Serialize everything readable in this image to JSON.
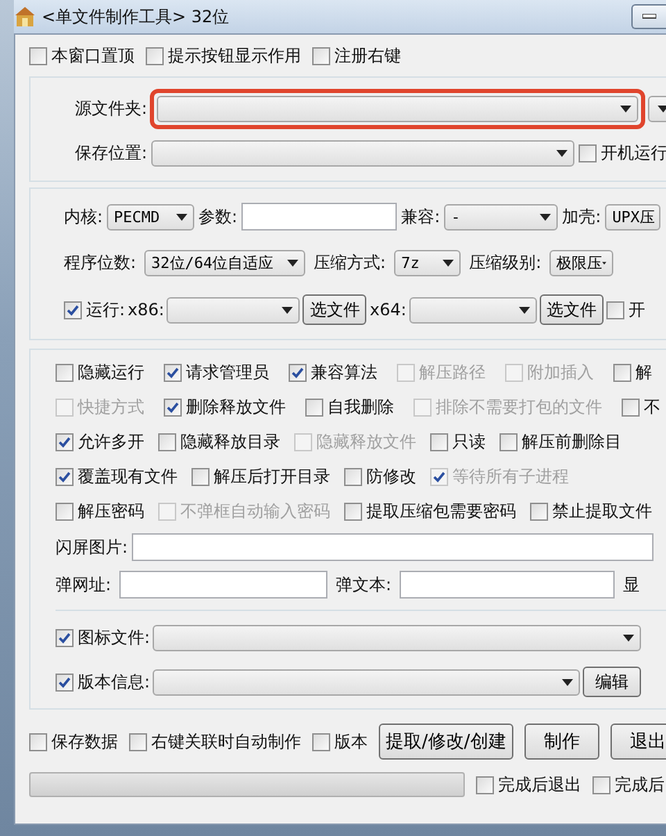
{
  "window": {
    "title": "<单文件制作工具> 32位"
  },
  "top_options": [
    {
      "label": "本窗口置顶",
      "checked": false
    },
    {
      "label": "提示按钮显示作用",
      "checked": false
    },
    {
      "label": "注册右键",
      "checked": false
    }
  ],
  "source": {
    "label": "源文件夹:",
    "highlighted": true
  },
  "save": {
    "label": "保存位置:"
  },
  "autostart": {
    "label": "开机运行",
    "checked": false
  },
  "core": {
    "label": "内核:",
    "value": "PECMD"
  },
  "params": {
    "label": "参数:"
  },
  "compat": {
    "label": "兼容:",
    "value": "-"
  },
  "packer": {
    "label": "加壳:",
    "value": "UPX压"
  },
  "bits": {
    "label": "程序位数:",
    "value": "32位/64位自适应"
  },
  "compression": {
    "label": "压缩方式:",
    "value": "7z"
  },
  "compression_level": {
    "label": "压缩级别:",
    "value": "极限压"
  },
  "run": {
    "label": "运行:",
    "checked": true,
    "x86_label": "x86:",
    "x86_button": "选文件",
    "x64_label": "x64:",
    "x64_button": "选文件"
  },
  "run_extra": {
    "label": "开",
    "checked": false
  },
  "options": [
    [
      {
        "label": "隐藏运行",
        "checked": false,
        "disabled": false
      },
      {
        "label": "请求管理员",
        "checked": true,
        "disabled": false
      },
      {
        "label": "兼容算法",
        "checked": true,
        "disabled": false
      },
      {
        "label": "解压路径",
        "checked": false,
        "disabled": true
      },
      {
        "label": "附加插入",
        "checked": false,
        "disabled": true
      },
      {
        "label": "解",
        "checked": false,
        "disabled": false
      }
    ],
    [
      {
        "label": "快捷方式",
        "checked": false,
        "disabled": true
      },
      {
        "label": "删除释放文件",
        "checked": true,
        "disabled": false
      },
      {
        "label": "自我删除",
        "checked": false,
        "disabled": false
      },
      {
        "label": "排除不需要打包的文件",
        "checked": false,
        "disabled": true
      },
      {
        "label": "不",
        "checked": false,
        "disabled": false
      }
    ],
    [
      {
        "label": "允许多开",
        "checked": true,
        "disabled": false
      },
      {
        "label": "隐藏释放目录",
        "checked": false,
        "disabled": false
      },
      {
        "label": "隐藏释放文件",
        "checked": false,
        "disabled": true
      },
      {
        "label": "只读",
        "checked": false,
        "disabled": false
      },
      {
        "label": "解压前删除目",
        "checked": false,
        "disabled": false
      }
    ],
    [
      {
        "label": "覆盖现有文件",
        "checked": true,
        "disabled": false
      },
      {
        "label": "解压后打开目录",
        "checked": false,
        "disabled": false
      },
      {
        "label": "防修改",
        "checked": false,
        "disabled": false
      },
      {
        "label": "等待所有子进程",
        "checked": true,
        "disabled": true
      }
    ],
    [
      {
        "label": "解压密码",
        "checked": false,
        "disabled": false
      },
      {
        "label": "不弹框自动输入密码",
        "checked": false,
        "disabled": true
      },
      {
        "label": "提取压缩包需要密码",
        "checked": false,
        "disabled": false
      },
      {
        "label": "禁止提取文件",
        "checked": false,
        "disabled": false
      }
    ]
  ],
  "splash": {
    "label": "闪屏图片:"
  },
  "popup_url": {
    "label": "弹网址:"
  },
  "popup_text": {
    "label": "弹文本:"
  },
  "show_label": "显",
  "icon_file": {
    "label": "图标文件:",
    "checked": true
  },
  "version_info": {
    "label": "版本信息:",
    "checked": true,
    "button": "编辑"
  },
  "footer_options": [
    {
      "label": "保存数据",
      "checked": false
    },
    {
      "label": "右键关联时自动制作",
      "checked": false
    },
    {
      "label": "版本",
      "checked": false
    }
  ],
  "buttons": [
    "提取/修改/创建",
    "制作",
    "退出"
  ],
  "progress": {
    "level": 0
  },
  "finish_options": [
    {
      "label": "完成后退出",
      "checked": false
    },
    {
      "label": "完成后",
      "checked": false
    }
  ]
}
